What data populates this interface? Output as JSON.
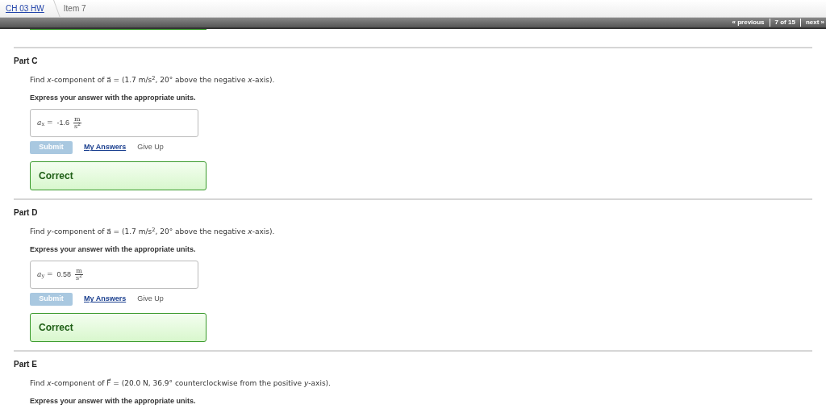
{
  "breadcrumb": {
    "link": "CH 03 HW",
    "current": "Item 7"
  },
  "pager": {
    "previous": "« previous",
    "position": "7 of 15",
    "next": "next »"
  },
  "parts": [
    {
      "title": "Part C",
      "question": "Find *x*-component of a⃗ = (1.7 m/s$^{2}$, 20° above the negative *x*-axis).",
      "instruction": "Express your answer with the appropriate units.",
      "answer": {
        "label": "*a*$_{x}$ =",
        "value": "-1.6",
        "unit_numerator": "m",
        "unit_denominator": "s$^{2}$"
      },
      "submit": {
        "label": "Submit",
        "disabled": true
      },
      "links": [
        "My Answers",
        "Give Up"
      ],
      "feedback": "Correct"
    },
    {
      "title": "Part D",
      "question": "Find *y*-component of a⃗ = (1.7 m/s$^{2}$, 20° above the negative *x*-axis).",
      "instruction": "Express your answer with the appropriate units.",
      "answer": {
        "label": "*a*$_{y}$ =",
        "value": "0.58",
        "unit_numerator": "m",
        "unit_denominator": "s$^{2}$"
      },
      "submit": {
        "label": "Submit",
        "disabled": true
      },
      "links": [
        "My Answers",
        "Give Up"
      ],
      "feedback": "Correct"
    },
    {
      "title": "Part E",
      "question": "Find *x*-component of F⃗ = (20.0 N, 36.9° counterclockwise from the positive *y*-axis).",
      "instruction": "Express your answer with the appropriate units."
    }
  ]
}
